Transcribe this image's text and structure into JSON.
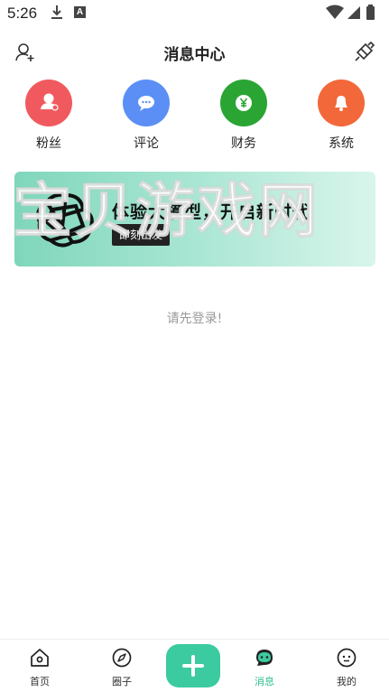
{
  "status_bar": {
    "time": "5:26"
  },
  "header": {
    "title": "消息中心"
  },
  "categories": [
    {
      "label": "粉丝",
      "color": "#f05a5f",
      "icon": "person-icon"
    },
    {
      "label": "评论",
      "color": "#5b8ff5",
      "icon": "comment-icon"
    },
    {
      "label": "财务",
      "color": "#2aa534",
      "icon": "yen-icon"
    },
    {
      "label": "系统",
      "color": "#f2683a",
      "icon": "bell-icon"
    }
  ],
  "banner": {
    "headline": "体验大模型，开启新时代",
    "button_label": "即刻出发"
  },
  "watermark": "宝贝游戏网",
  "empty_text": "请先登录!",
  "tabs": [
    {
      "label": "首页",
      "icon": "home-icon"
    },
    {
      "label": "圈子",
      "icon": "compass-icon"
    },
    {
      "label": "",
      "icon": "plus-icon"
    },
    {
      "label": "消息",
      "icon": "message-icon",
      "active": true
    },
    {
      "label": "我的",
      "icon": "profile-icon"
    }
  ],
  "accent_color": "#3ccaa0"
}
